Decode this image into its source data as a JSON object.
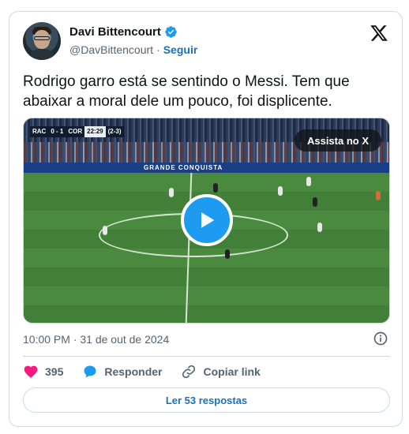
{
  "author": {
    "name": "Davi Bittencourt",
    "handle": "@DavBittencourt",
    "separator": "·",
    "follow_label": "Seguir"
  },
  "tweet": {
    "text": "Rodrigo garro está se sentindo o Messi. Tem que abaixar a moral dele um pouco, foi displicente.",
    "timestamp": "10:00 PM · 31 de out de 2024"
  },
  "media": {
    "watch_label": "Assista no X",
    "scorebug": {
      "home": "RAC",
      "score": "0 - 1",
      "away": "COR",
      "clock": "22:29",
      "aggregate": "(2-3)"
    },
    "adboard_text": "GRANDE CONQUISTA"
  },
  "actions": {
    "likes": "395",
    "reply_label": "Responder",
    "copy_label": "Copiar link"
  },
  "replies_button": "Ler 53 respostas",
  "colors": {
    "accent": "#1d9bf0",
    "link": "#1d6fb8",
    "like": "#f91880",
    "muted": "#536471"
  },
  "icons": [
    "verified-badge-icon",
    "x-logo-icon",
    "play-icon",
    "info-icon",
    "heart-icon",
    "reply-bubble-icon",
    "link-icon"
  ]
}
